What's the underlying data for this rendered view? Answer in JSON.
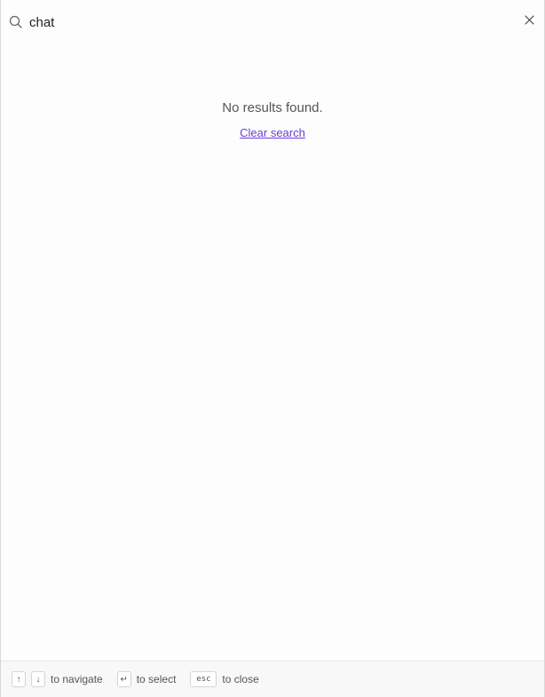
{
  "search": {
    "value": "chat",
    "icon": "search-icon",
    "close_icon": "close-icon"
  },
  "empty_state": {
    "message": "No results found.",
    "clear_label": "Clear search"
  },
  "footer": {
    "navigate_keys": [
      "↑",
      "↓"
    ],
    "navigate_label": "to navigate",
    "select_key": "↵",
    "select_label": "to select",
    "close_key": "esc",
    "close_label": "to close"
  },
  "colors": {
    "link": "#6a3fd1",
    "muted_text": "#555555",
    "background": "#fdfdfd"
  }
}
